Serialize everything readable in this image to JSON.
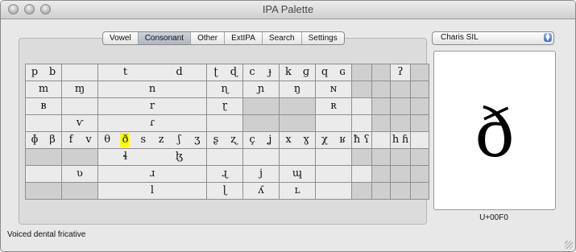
{
  "window": {
    "title": "IPA Palette"
  },
  "tabs": [
    {
      "label": "Vowel",
      "active": false
    },
    {
      "label": "Consonant",
      "active": true
    },
    {
      "label": "Other",
      "active": false
    },
    {
      "label": "ExtIPA",
      "active": false
    },
    {
      "label": "Search",
      "active": false
    },
    {
      "label": "Settings",
      "active": false
    }
  ],
  "consonant_grid": [
    [
      {
        "chars": [
          "p",
          "b"
        ]
      },
      {
        "chars": []
      },
      {
        "chars": [
          "t",
          "d"
        ]
      },
      {
        "chars": [
          "ʈ",
          "ɖ"
        ]
      },
      {
        "chars": [
          "c",
          "ɟ"
        ]
      },
      {
        "chars": [
          "k",
          "ɡ"
        ]
      },
      {
        "chars": [
          "q",
          "ɢ"
        ]
      },
      {
        "chars": [],
        "dark": true
      },
      {
        "chars": [],
        "dark": true
      },
      {
        "chars": [
          "ʔ"
        ]
      },
      {
        "chars": [],
        "dark": true
      }
    ],
    [
      {
        "chars": [
          "m"
        ]
      },
      {
        "chars": [
          "ɱ"
        ]
      },
      {
        "chars": [
          "n"
        ]
      },
      {
        "chars": [
          "ɳ"
        ]
      },
      {
        "chars": [
          "ɲ"
        ]
      },
      {
        "chars": [
          "ŋ"
        ]
      },
      {
        "chars": [
          "ɴ"
        ]
      },
      {
        "chars": [],
        "dark": true
      },
      {
        "chars": [],
        "dark": true
      },
      {
        "chars": [],
        "dark": true
      },
      {
        "chars": [],
        "dark": true
      }
    ],
    [
      {
        "chars": [
          "ʙ"
        ]
      },
      {
        "chars": []
      },
      {
        "chars": [
          "r"
        ]
      },
      {
        "chars": [
          "ɽ"
        ]
      },
      {
        "chars": [],
        "dark": true
      },
      {
        "chars": [],
        "dark": true
      },
      {
        "chars": [
          "ʀ"
        ]
      },
      {
        "chars": []
      },
      {
        "chars": [],
        "dark": true
      },
      {
        "chars": [],
        "dark": true
      },
      {
        "chars": [],
        "dark": true
      }
    ],
    [
      {
        "chars": []
      },
      {
        "chars": [
          "ⱱ"
        ]
      },
      {
        "chars": [
          "ɾ"
        ]
      },
      {
        "chars": []
      },
      {
        "chars": [],
        "dark": true
      },
      {
        "chars": [],
        "dark": true
      },
      {
        "chars": []
      },
      {
        "chars": []
      },
      {
        "chars": [],
        "dark": true
      },
      {
        "chars": [],
        "dark": true
      },
      {
        "chars": [],
        "dark": true
      }
    ],
    [
      {
        "chars": [
          "ɸ",
          "β"
        ]
      },
      {
        "chars": [
          "f",
          "v"
        ]
      },
      {
        "chars": [
          "θ",
          "ð",
          "s",
          "z",
          "ʃ",
          "ʒ"
        ]
      },
      {
        "chars": [
          "ʂ",
          "ʐ"
        ]
      },
      {
        "chars": [
          "ç",
          "ʝ"
        ]
      },
      {
        "chars": [
          "x",
          "ɣ"
        ]
      },
      {
        "chars": [
          "χ",
          "ʁ"
        ]
      },
      {
        "chars": [
          "ħ",
          "ʕ"
        ]
      },
      {
        "chars": []
      },
      {
        "chars": [
          "h",
          "ɦ"
        ]
      },
      {
        "chars": []
      }
    ],
    [
      {
        "chars": [],
        "dark": true
      },
      {
        "chars": [],
        "dark": true
      },
      {
        "chars": [
          "ɬ",
          "ɮ"
        ]
      },
      {
        "chars": []
      },
      {
        "chars": []
      },
      {
        "chars": []
      },
      {
        "chars": []
      },
      {
        "chars": [],
        "dark": true
      },
      {
        "chars": [],
        "dark": true
      },
      {
        "chars": [],
        "dark": true
      },
      {
        "chars": [],
        "dark": true
      }
    ],
    [
      {
        "chars": []
      },
      {
        "chars": [
          "ʋ"
        ]
      },
      {
        "chars": [
          "ɹ"
        ]
      },
      {
        "chars": [
          "ɻ"
        ]
      },
      {
        "chars": [
          "j"
        ]
      },
      {
        "chars": [
          "ɰ"
        ]
      },
      {
        "chars": []
      },
      {
        "chars": []
      },
      {
        "chars": [],
        "dark": true
      },
      {
        "chars": [],
        "dark": true
      },
      {
        "chars": [],
        "dark": true
      }
    ],
    [
      {
        "chars": [],
        "dark": true
      },
      {
        "chars": [],
        "dark": true
      },
      {
        "chars": [
          "l"
        ]
      },
      {
        "chars": [
          "ɭ"
        ]
      },
      {
        "chars": [
          "ʎ"
        ]
      },
      {
        "chars": [
          "ʟ"
        ]
      },
      {
        "chars": []
      },
      {
        "chars": [],
        "dark": true
      },
      {
        "chars": [],
        "dark": true
      },
      {
        "chars": [],
        "dark": true
      },
      {
        "chars": [],
        "dark": true
      }
    ]
  ],
  "selected_char": "ð",
  "font_select": {
    "value": "Charis SIL"
  },
  "preview": {
    "glyph": "ð",
    "codepoint": "U+00F0"
  },
  "status": {
    "text": "Voiced dental fricative"
  },
  "colors": {
    "highlight": "#ffff00",
    "tab_active": "#b8c0c8",
    "dark_cell": "#cfcfcf"
  }
}
